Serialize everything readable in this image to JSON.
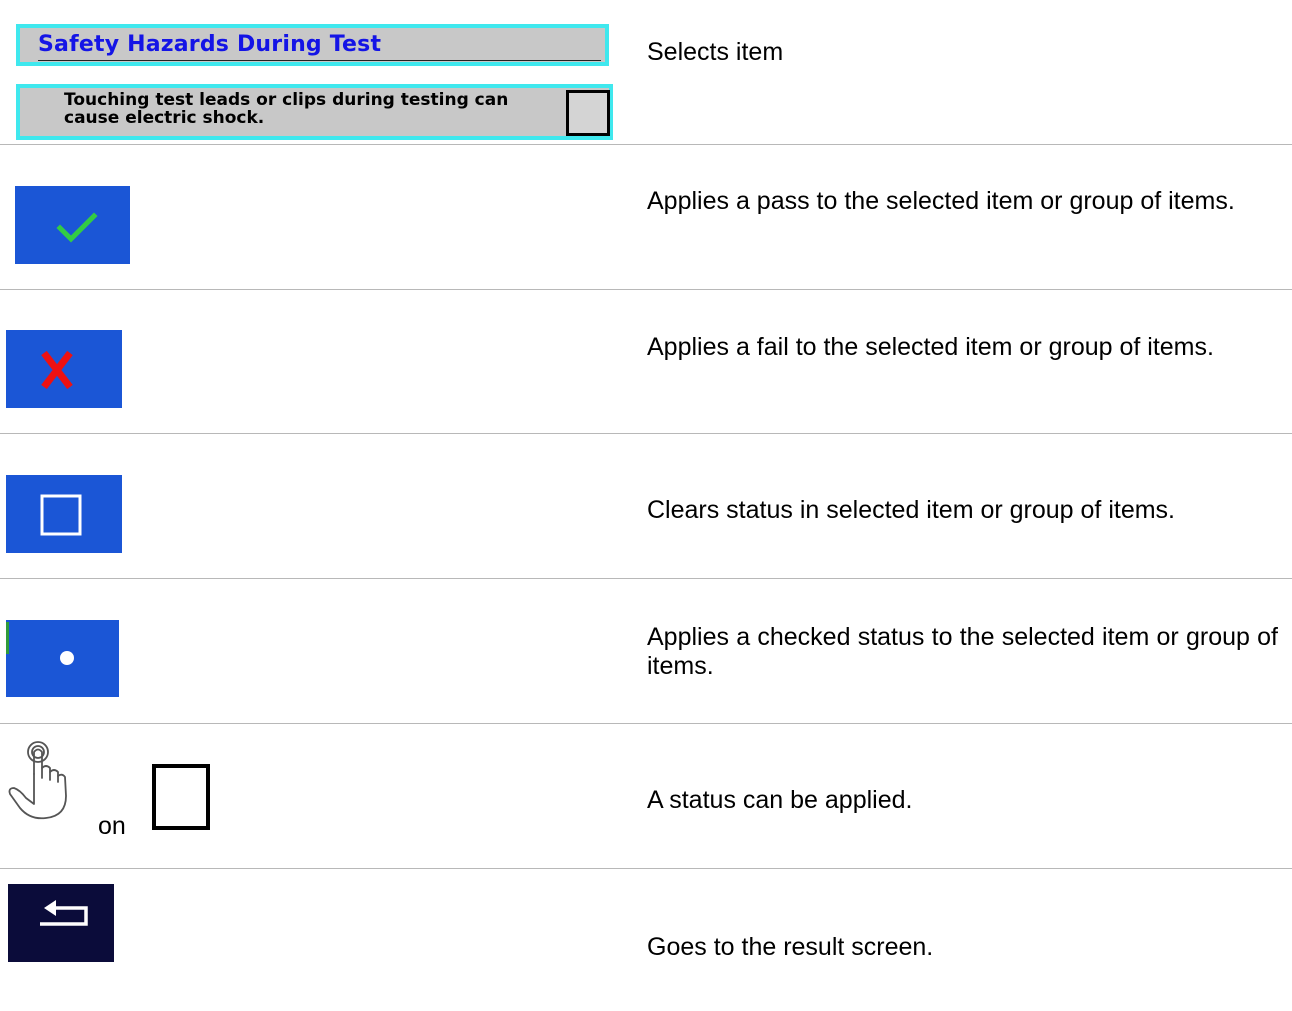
{
  "colors": {
    "tile_blue": "#1b56d6",
    "tile_dark": "#0b0c3a",
    "highlight_cyan": "#3fe8ee",
    "item_grey": "#c8c8c8",
    "title_blue": "#1414e6",
    "pass_green": "#33cc44",
    "fail_red": "#ee1111"
  },
  "rows": [
    {
      "item_title": "Safety Hazards During Test",
      "item_text": "Touching  test leads or clips during testing can cause electric shock.",
      "description": "Selects item"
    },
    {
      "icon": "pass-check-icon",
      "description": "Applies a pass to the selected item or group of items."
    },
    {
      "icon": "fail-cross-icon",
      "description": "Applies a fail to the selected item or group of items."
    },
    {
      "icon": "clear-empty-box-icon",
      "description": "Clears status in selected item or group of items."
    },
    {
      "icon": "checked-dot-icon",
      "description": "Applies a checked status to the selected item or group of items."
    },
    {
      "icon": "tap-hand-icon",
      "on_label": "on",
      "description": "A status can be applied."
    },
    {
      "icon": "back-arrow-icon",
      "description": "Goes to the result screen."
    }
  ]
}
